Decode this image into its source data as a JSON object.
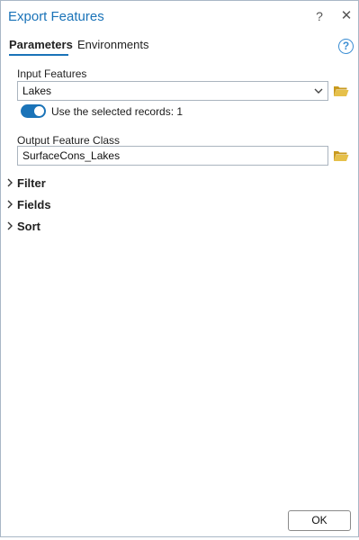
{
  "window": {
    "title": "Export Features",
    "help_glyph": "?",
    "close_glyph": "✕"
  },
  "tabs": {
    "items": [
      {
        "label": "Parameters",
        "active": true
      },
      {
        "label": "Environments",
        "active": false
      }
    ],
    "help_glyph": "?"
  },
  "input_features": {
    "label": "Input Features",
    "value": "Lakes",
    "browse_icon": "folder-open-icon"
  },
  "use_selected": {
    "label": "Use the selected records: 1",
    "on": true
  },
  "output_feature_class": {
    "label": "Output Feature Class",
    "value": "SurfaceCons_Lakes",
    "browse_icon": "folder-open-icon"
  },
  "sections": [
    {
      "label": "Filter",
      "expanded": false
    },
    {
      "label": "Fields",
      "expanded": false
    },
    {
      "label": "Sort",
      "expanded": false
    }
  ],
  "footer": {
    "ok_label": "OK"
  },
  "colors": {
    "accent": "#1a73b8",
    "folder": "#d9b23c"
  }
}
